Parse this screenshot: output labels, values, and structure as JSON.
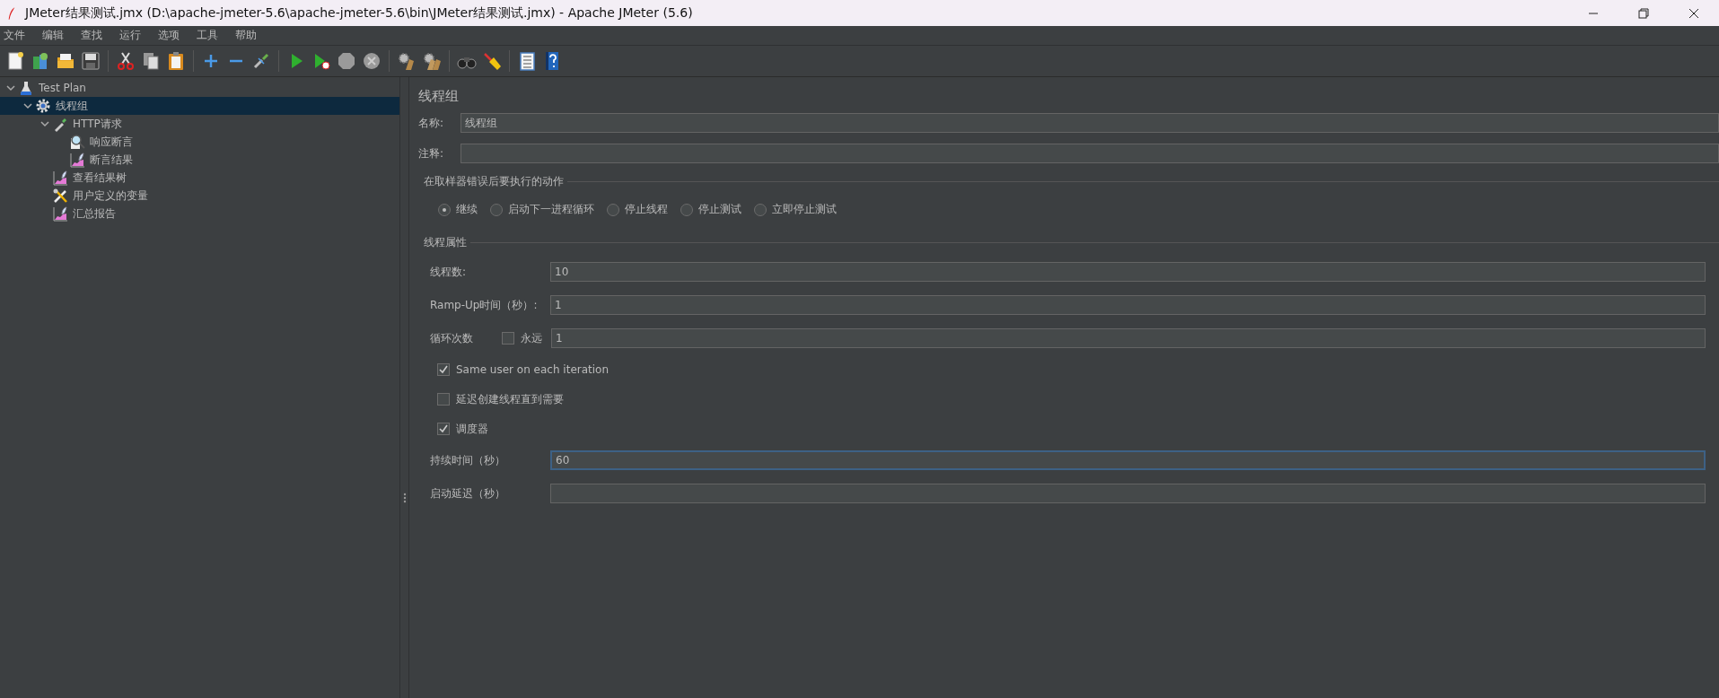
{
  "window": {
    "title": "JMeter结果测试.jmx (D:\\apache-jmeter-5.6\\apache-jmeter-5.6\\bin\\JMeter结果测试.jmx) - Apache JMeter (5.6)"
  },
  "menu": [
    "文件",
    "编辑",
    "查找",
    "运行",
    "选项",
    "工具",
    "帮助"
  ],
  "toolbar": [
    {
      "kind": "new"
    },
    {
      "kind": "templates"
    },
    {
      "kind": "open"
    },
    {
      "kind": "save"
    },
    {
      "kind": "sep"
    },
    {
      "kind": "cut"
    },
    {
      "kind": "copy"
    },
    {
      "kind": "paste"
    },
    {
      "kind": "sep"
    },
    {
      "kind": "expand"
    },
    {
      "kind": "collapse"
    },
    {
      "kind": "toggle"
    },
    {
      "kind": "sep"
    },
    {
      "kind": "start"
    },
    {
      "kind": "start_nopause"
    },
    {
      "kind": "stop"
    },
    {
      "kind": "shutdown"
    },
    {
      "kind": "sep"
    },
    {
      "kind": "clear"
    },
    {
      "kind": "clear_all"
    },
    {
      "kind": "sep"
    },
    {
      "kind": "search"
    },
    {
      "kind": "reset"
    },
    {
      "kind": "sep"
    },
    {
      "kind": "functions"
    },
    {
      "kind": "help"
    }
  ],
  "tree": [
    {
      "label": "Test Plan",
      "kind": "flask",
      "expanded": true,
      "selected": false,
      "children": [
        {
          "label": "线程组",
          "kind": "gear",
          "expanded": true,
          "selected": true,
          "children": [
            {
              "label": "HTTP请求",
              "kind": "dropper",
              "expanded": true,
              "selected": false,
              "children": [
                {
                  "label": "响应断言",
                  "kind": "magnifier",
                  "selected": false
                },
                {
                  "label": "断言结果",
                  "kind": "graph",
                  "selected": false
                }
              ]
            },
            {
              "label": "查看结果树",
              "kind": "graph",
              "selected": false
            },
            {
              "label": "用户定义的变量",
              "kind": "tools",
              "selected": false
            },
            {
              "label": "汇总报告",
              "kind": "graph",
              "selected": false
            }
          ]
        }
      ]
    }
  ],
  "panel": {
    "title": "线程组",
    "name": {
      "label": "名称:",
      "value": "线程组"
    },
    "comment": {
      "label": "注释:"
    },
    "error_action": {
      "legend": "在取样器错误后要执行的动作",
      "options": [
        {
          "label": "继续",
          "selected": true
        },
        {
          "label": "启动下一进程循环",
          "selected": false
        },
        {
          "label": "停止线程",
          "selected": false
        },
        {
          "label": "停止测试",
          "selected": false
        },
        {
          "label": "立即停止测试",
          "selected": false
        }
      ]
    },
    "thread_properties": {
      "legend": "线程属性",
      "rows": [
        {
          "kind": "field",
          "label": "线程数:",
          "value": "10",
          "focused": false
        },
        {
          "kind": "field",
          "label": "Ramp-Up时间（秒）:",
          "value": "1",
          "focused": false
        },
        {
          "kind": "loop",
          "label": "循环次数",
          "checkbox": {
            "label": "永远",
            "checked": false
          },
          "value": "1"
        },
        {
          "kind": "checkbox",
          "label": "Same user on each iteration",
          "checked": true
        },
        {
          "kind": "checkbox",
          "label": "延迟创建线程直到需要",
          "checked": false
        },
        {
          "kind": "checkbox",
          "label": "调度器",
          "checked": true
        },
        {
          "kind": "field",
          "label": "持续时间（秒）",
          "value": "60",
          "focused": true
        },
        {
          "kind": "field",
          "label": "启动延迟（秒）",
          "focused": false
        }
      ]
    }
  }
}
